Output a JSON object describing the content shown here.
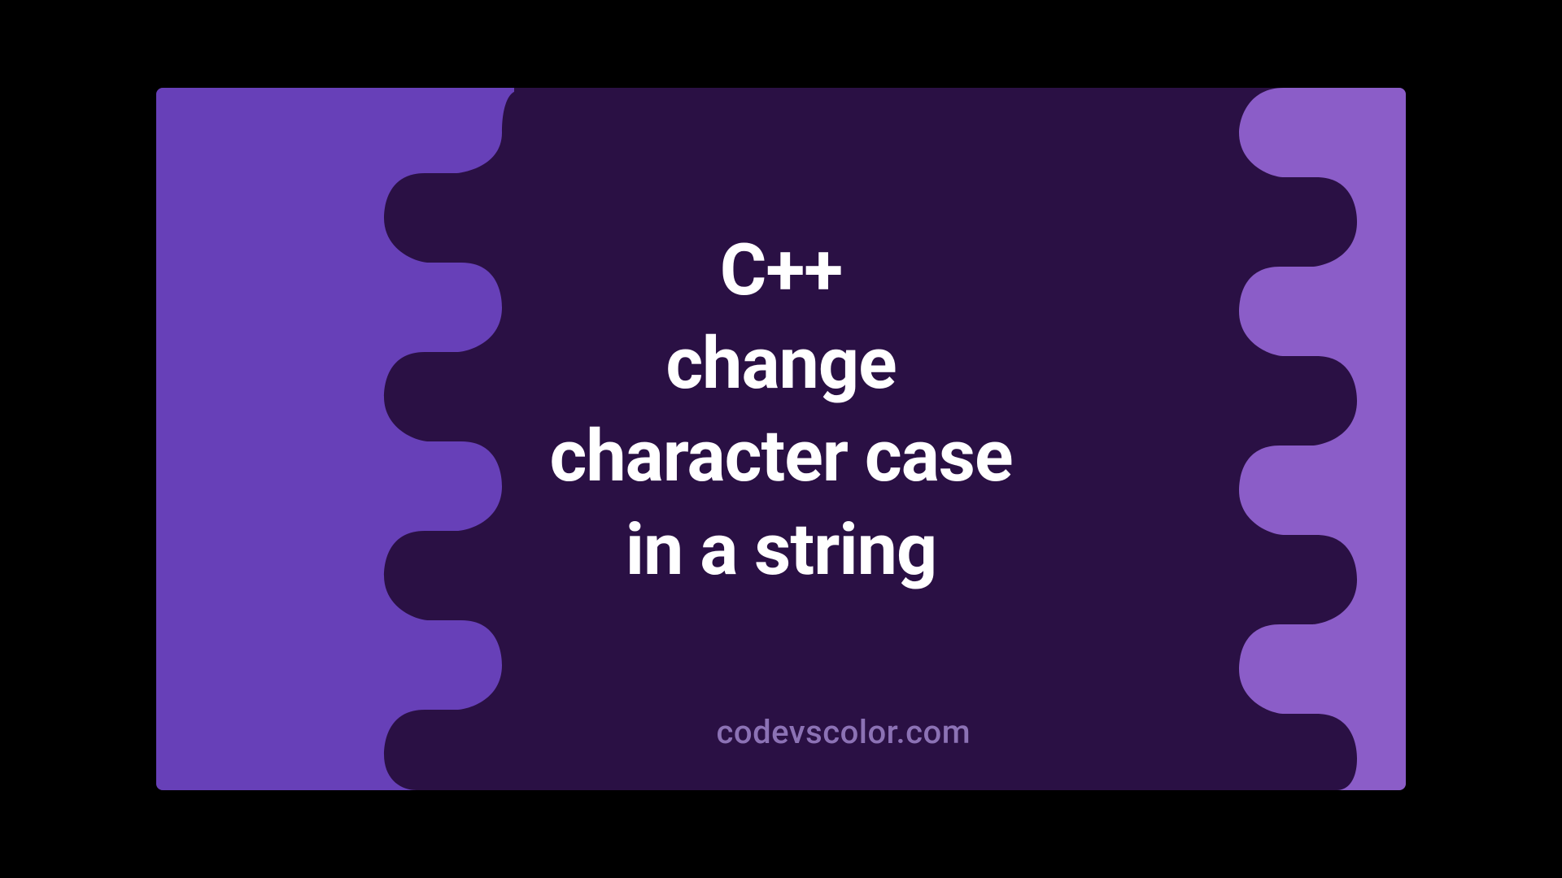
{
  "title_lines": "C++\nchange\ncharacter case\nin a string",
  "credit": "codevscolor.com",
  "colors": {
    "background_dark": "#2a1044",
    "blob_left": "#6740b8",
    "blob_right": "#8b5dc8",
    "title_text": "#ffffff",
    "credit_text": "#8c72b5"
  }
}
